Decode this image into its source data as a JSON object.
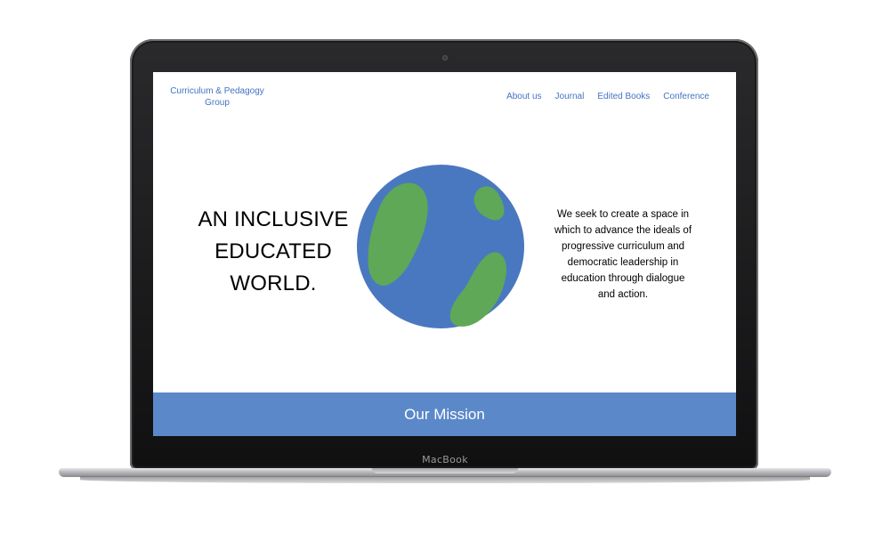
{
  "device": {
    "label": "MacBook"
  },
  "site": {
    "brand": "Curriculum & Pedagogy Group",
    "nav": [
      {
        "label": "About us"
      },
      {
        "label": "Journal"
      },
      {
        "label": "Edited Books"
      },
      {
        "label": "Conference"
      }
    ],
    "hero": {
      "headline": "AN INCLUSIVE EDUCATED WORLD.",
      "description": "We seek to create a space in which to advance the ideals of progressive curriculum and democratic leadership in education through dialogue and action.",
      "illustration_icon": "globe-icon"
    },
    "section_bar": {
      "label": "Our Mission"
    }
  },
  "colors": {
    "accent": "#4472c4",
    "bar": "#5b88c9",
    "ocean": "#4a78c0",
    "land": "#5fa857"
  }
}
